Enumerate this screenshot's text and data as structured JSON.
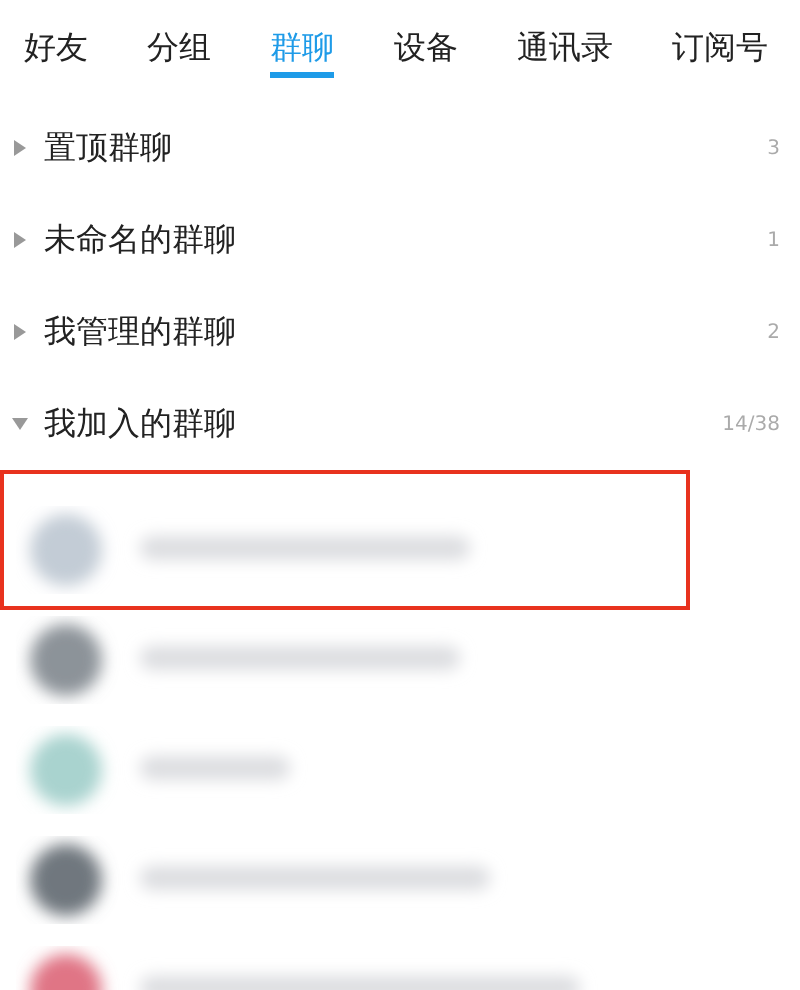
{
  "tabs": [
    {
      "label": "好友",
      "selected": false
    },
    {
      "label": "分组",
      "selected": false
    },
    {
      "label": "群聊",
      "selected": true
    },
    {
      "label": "设备",
      "selected": false
    },
    {
      "label": "通讯录",
      "selected": false
    },
    {
      "label": "订阅号",
      "selected": false
    }
  ],
  "groups": [
    {
      "name": "置顶群聊",
      "count": "3",
      "expanded": false
    },
    {
      "name": "未命名的群聊",
      "count": "1",
      "expanded": false
    },
    {
      "name": "我管理的群聊",
      "count": "2",
      "expanded": false
    },
    {
      "name": "我加入的群聊",
      "count": "14/38",
      "expanded": true,
      "children": [
        {
          "kind": "blurred",
          "color": "#c3ccd6",
          "highlighted": true
        },
        {
          "kind": "blurred",
          "color": "#8c9399",
          "highlighted": false
        },
        {
          "kind": "blurred",
          "color": "#a9d3cf",
          "highlighted": false
        },
        {
          "kind": "blurred",
          "color": "#6f777e",
          "highlighted": false
        },
        {
          "kind": "blurred",
          "color": "#e07585",
          "highlighted": false
        }
      ]
    }
  ]
}
